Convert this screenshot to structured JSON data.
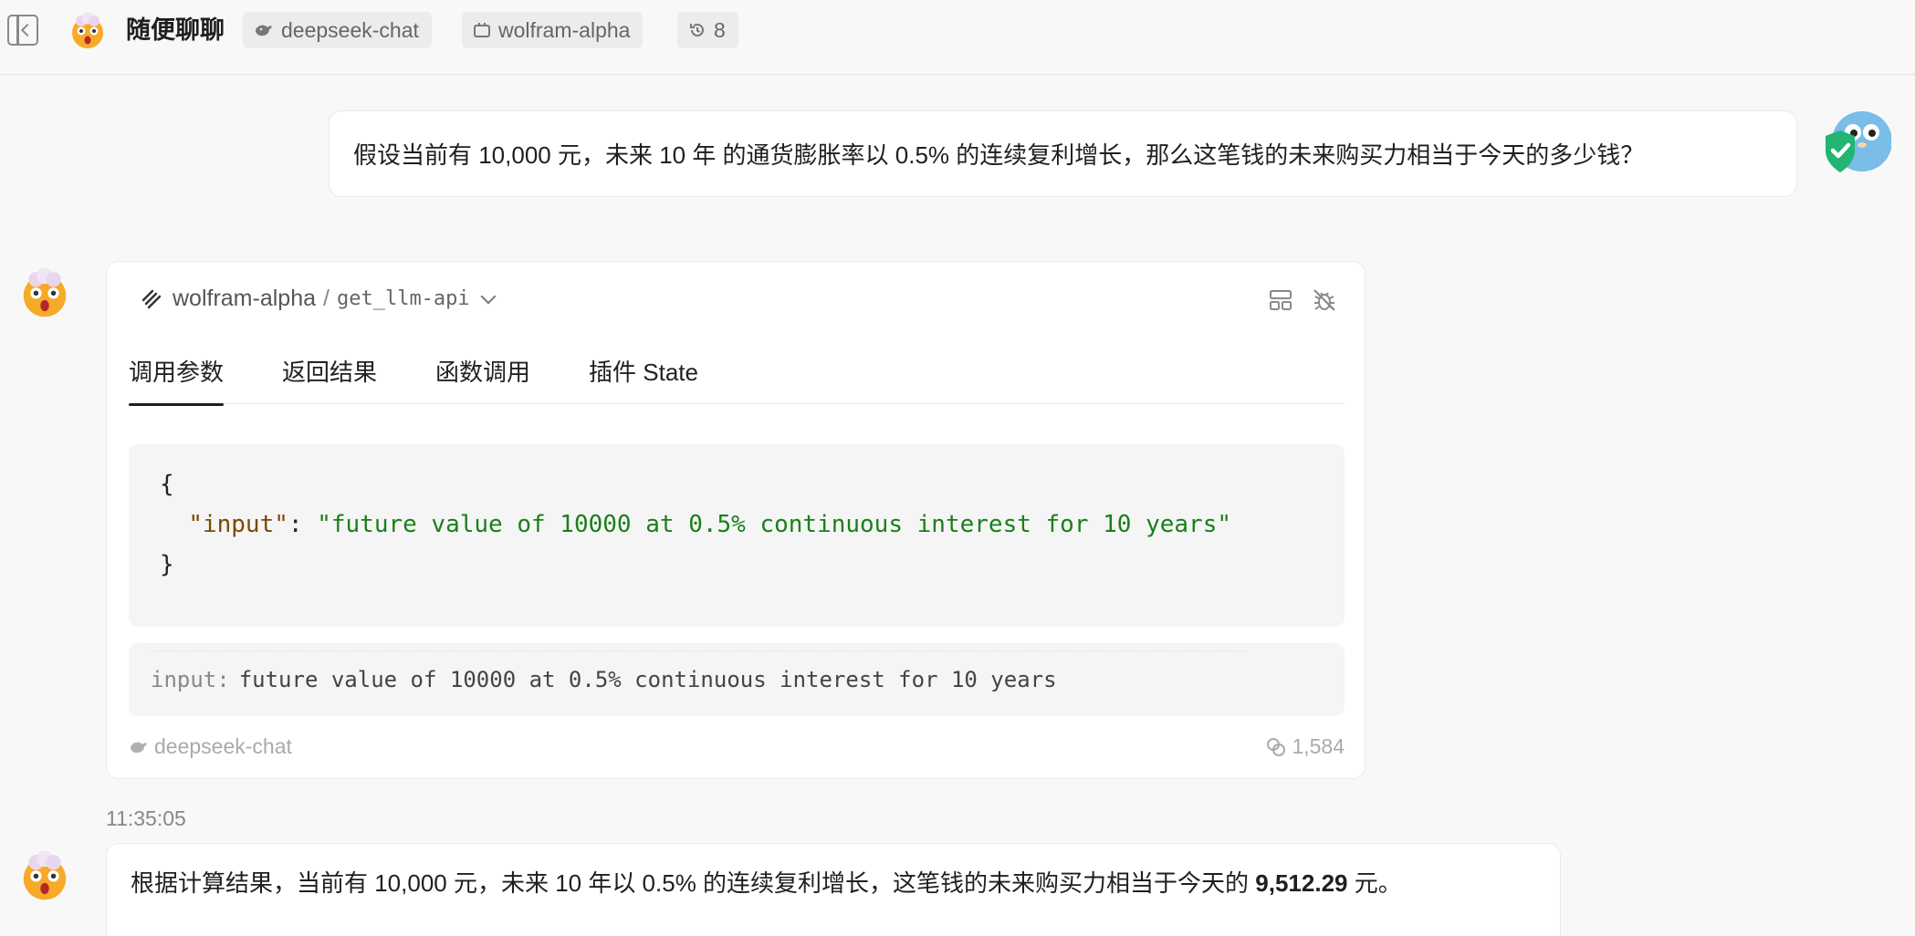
{
  "header": {
    "title": "随便聊聊",
    "model_chip": "deepseek-chat",
    "plugin_chip": "wolfram-alpha",
    "history_count": "8"
  },
  "user_message": {
    "text": "假设当前有 10,000 元，未来 10 年 的通货膨胀率以 0.5% 的连续复利增长，那么这笔钱的未来购买力相当于今天的多少钱？"
  },
  "tool_call": {
    "plugin": "wolfram-alpha",
    "separator": "/",
    "function": "get_llm-api",
    "tabs": [
      "调用参数",
      "返回结果",
      "函数调用",
      "插件 State"
    ],
    "active_tab": 0,
    "code_open": "{",
    "code_key": "\"input\"",
    "code_colon": ": ",
    "code_value": "\"future value of 10000 at 0.5% continuous interest for 10 years\"",
    "code_close": "}",
    "result_key": "input:",
    "result_value": "future value of 10000 at 0.5% continuous interest for 10 years",
    "model": "deepseek-chat",
    "tokens": "1,584"
  },
  "timestamp": "11:35:05",
  "answer": {
    "prefix": "根据计算结果，当前有 10,000 元，未来 10 年以 0.5% 的连续复利增长，这笔钱的未来购买力相当于今天的 ",
    "amount": "9,512.29",
    "suffix": " 元。"
  },
  "colors": {
    "background": "#f8f8f8",
    "code_key": "#7a4a00",
    "code_string": "#1a7f1a",
    "success_green": "#22b573"
  }
}
